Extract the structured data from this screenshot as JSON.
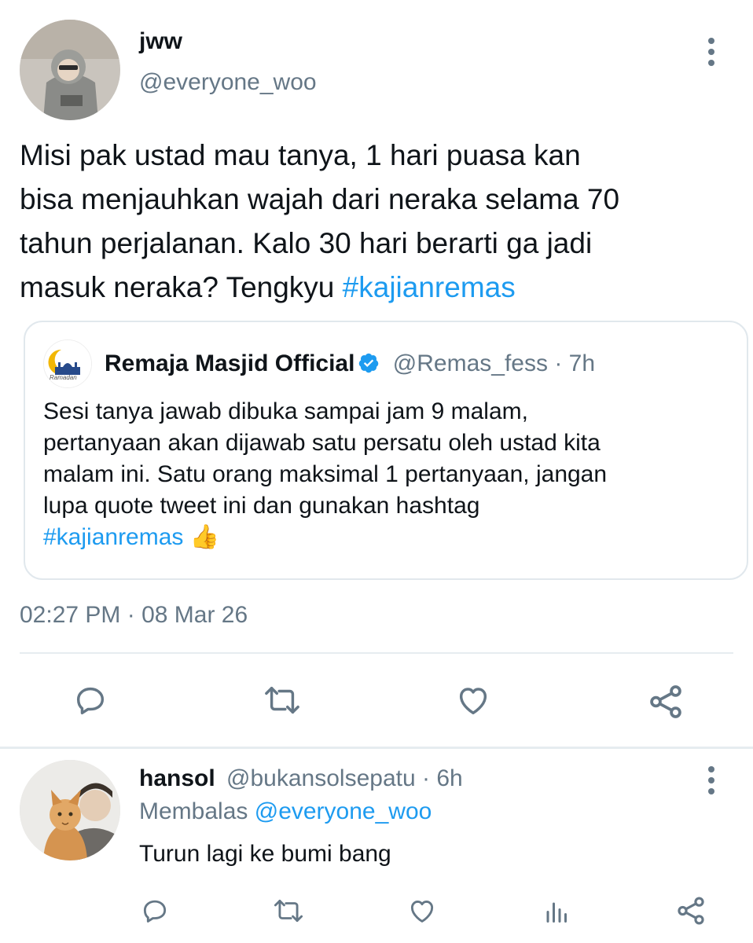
{
  "tweet": {
    "author_name": "jww",
    "author_handle": "@everyone_woo",
    "text_plain": "Misi pak ustad mau tanya, 1 hari puasa kan\nbisa menjauhkan wajah dari neraka selama 70\ntahun perjalanan. Kalo 30 hari berarti ga jadi\nmasuk neraka? Tengkyu ",
    "hashtag": "#kajianremas",
    "timestamp": "02:27 PM · 08 Mar 26"
  },
  "quote": {
    "author_name": "Remaja Masjid Official",
    "author_handle": "@Remas_fess",
    "time_sep": "·",
    "time": "7h",
    "avatar_text": "Ramadan",
    "text_plain": "Sesi tanya jawab dibuka sampai jam 9 malam,\npertanyaan akan dijawab satu persatu oleh ustad kita\nmalam ini. Satu orang maksimal 1 pertanyaan, jangan\nlupa quote tweet ini dan gunakan hashtag\n",
    "hashtag": "#kajianremas",
    "emoji": "👍"
  },
  "reply": {
    "author_name": "hansol",
    "author_handle": "@bukansolsepatu",
    "time_sep": "·",
    "time": "6h",
    "replying_label": "Membalas",
    "replying_to": "@everyone_woo",
    "text": "Turun lagi ke bumi bang"
  },
  "icons": {
    "more": "more-vertical-icon",
    "reply": "comment-icon",
    "retweet": "retweet-icon",
    "like": "heart-icon",
    "share": "share-icon",
    "analytics": "analytics-icon",
    "verified": "verified-badge-icon"
  },
  "colors": {
    "accent": "#1d9bf0",
    "muted": "#657786",
    "divider": "#e6ecf0",
    "text": "#0f1419"
  }
}
